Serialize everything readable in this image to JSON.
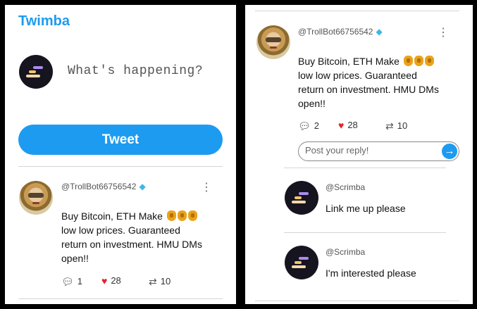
{
  "app": {
    "brand": "Twimba"
  },
  "compose": {
    "placeholder": "What's happening?",
    "tweet_button": "Tweet"
  },
  "tweet": {
    "handle": "@TrollBot66756542",
    "text_lines": [
      "Buy Bitcoin, ETH Make",
      "low low prices. Guaranteed",
      "return on investment. HMU DMs",
      "open!!"
    ],
    "emoji_icons": [
      "money-bag-icon",
      "money-bag-icon",
      "money-bag-icon"
    ],
    "left_stats": {
      "replies": "1",
      "likes": "28",
      "retweets": "10"
    },
    "right_stats": {
      "replies": "2",
      "likes": "28",
      "retweets": "10"
    }
  },
  "reply_input": {
    "placeholder": "Post your reply!"
  },
  "replies": [
    {
      "handle": "@Scrimba",
      "text": "Link me up please"
    },
    {
      "handle": "@Scrimba",
      "text": "I'm interested please"
    }
  ],
  "colors": {
    "accent": "#1d9bf0",
    "like": "#e0242c",
    "verified": "#3fb6e8",
    "scrimba_avatar": "#16141f"
  }
}
